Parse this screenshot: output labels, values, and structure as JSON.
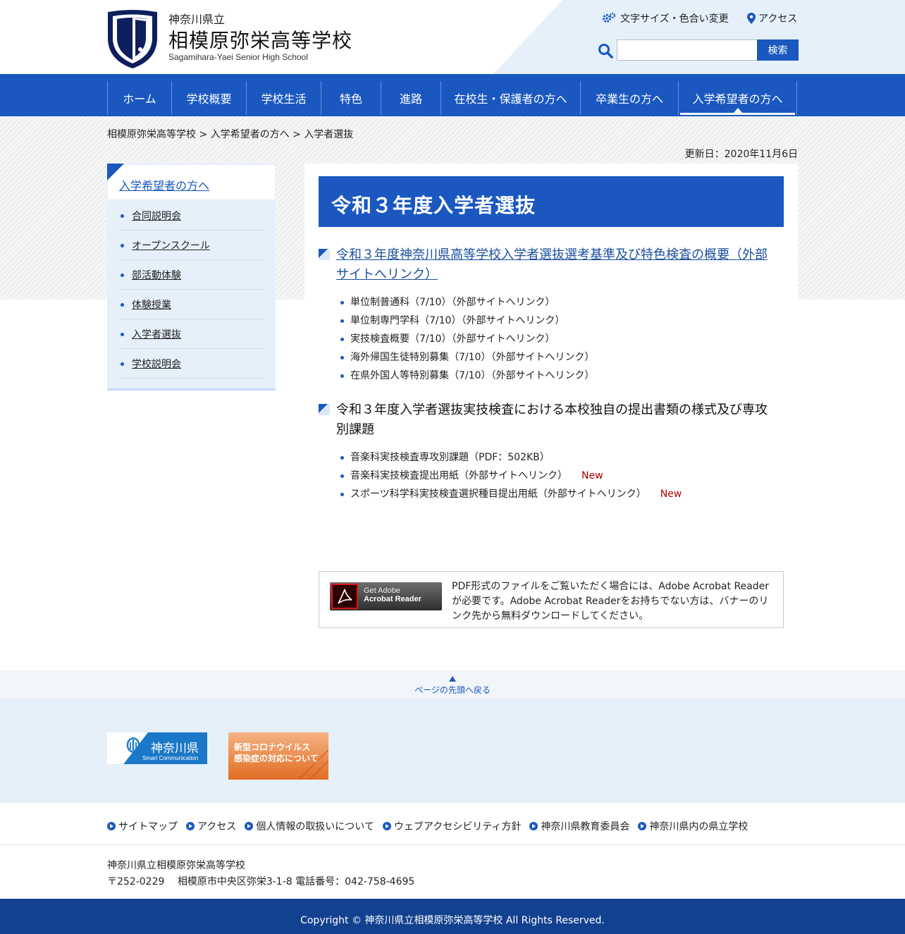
{
  "header": {
    "pref_label": "神奈川県立",
    "school_name": "相模原弥栄高等学校",
    "school_name_en": "Sagamihara-Yaei Senior High School",
    "font_size_link": "文字サイズ・色合い変更",
    "access_link": "アクセス",
    "search_placeholder": "",
    "search_button": "検索"
  },
  "nav": {
    "items": [
      {
        "label": "ホーム"
      },
      {
        "label": "学校概要"
      },
      {
        "label": "学校生活"
      },
      {
        "label": "特色"
      },
      {
        "label": "進路"
      },
      {
        "label": "在校生・保護者の方へ"
      },
      {
        "label": "卒業生の方へ"
      },
      {
        "label": "入学希望者の方へ"
      }
    ],
    "active": "入学希望者の方へ"
  },
  "breadcrumb": "相模原弥栄高等学校 > 入学希望者の方へ > 入学者選抜",
  "updated": "更新日：2020年11月6日",
  "sidenav": {
    "title": "入学希望者の方へ",
    "items": [
      {
        "label": "合同説明会"
      },
      {
        "label": "オープンスクール"
      },
      {
        "label": "部活動体験"
      },
      {
        "label": "体験授業"
      },
      {
        "label": "入学者選抜"
      },
      {
        "label": "学校説明会"
      }
    ]
  },
  "main": {
    "title": "令和３年度入学者選抜",
    "section1": {
      "heading": "令和３年度神奈川県高等学校入学者選抜選考基準及び特色検査の概要（外部サイトへリンク）",
      "items": [
        {
          "label": "単位制普通科（7/10）（外部サイトへリンク）"
        },
        {
          "label": "単位制専門学科（7/10）（外部サイトへリンク）"
        },
        {
          "label": "実技検査概要（7/10）（外部サイトへリンク）"
        },
        {
          "label": "海外帰国生徒特別募集（7/10）（外部サイトへリンク）"
        },
        {
          "label": "在県外国人等特別募集（7/10）（外部サイトへリンク）"
        }
      ]
    },
    "section2": {
      "heading": "令和３年度入学者選抜実技検査における本校独自の提出書類の様式及び専攻別課題",
      "items": [
        {
          "label": "音楽科実技検査専攻別課題（PDF：502KB）",
          "badge": ""
        },
        {
          "label": "音楽科実技検査提出用紙（外部サイトへリンク）",
          "badge": "New"
        },
        {
          "label": "スポーツ科学科実技検査選択種目提出用紙（外部サイトへリンク）",
          "badge": "New"
        }
      ]
    },
    "acrobat": {
      "get": "Get Adobe",
      "product": "Acrobat Reader",
      "text": "PDF形式のファイルをご覧いただく場合には、Adobe Acrobat Readerが必要です。Adobe Acrobat Readerをお持ちでない方は、バナーのリンク先から無料ダウンロードしてください。"
    }
  },
  "pagetop": "ページの先頭へ戻る",
  "banners": {
    "kanagawa_title": "神奈川県",
    "kanagawa_sub": "Smart Communication",
    "corona_line1": "新型コロナウイルス",
    "corona_line2": "感染症の対応について"
  },
  "footer": {
    "links": [
      {
        "label": "サイトマップ"
      },
      {
        "label": "アクセス"
      },
      {
        "label": "個人情報の取扱いについて"
      },
      {
        "label": "ウェブアクセシビリティ方針"
      },
      {
        "label": "神奈川県教育委員会"
      },
      {
        "label": "神奈川県内の県立学校"
      }
    ],
    "school": "神奈川県立相模原弥栄高等学校",
    "address": "〒252-0229　 相模原市中央区弥栄3-1-8 電話番号：042-758-4695",
    "copyright": "Copyright © 神奈川県立相模原弥栄高等学校 All Rights Reserved."
  },
  "colors": {
    "primary": "#1a58c0",
    "footer_dark": "#12418f",
    "light_bg": "#e6f0fb",
    "new_badge": "#aa0000"
  }
}
